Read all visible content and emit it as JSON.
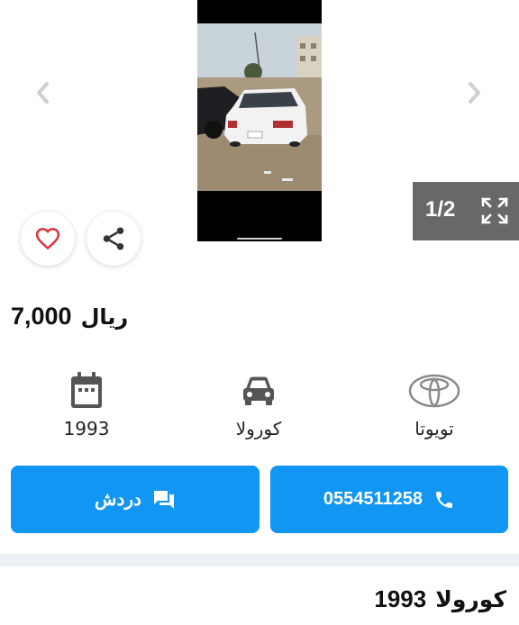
{
  "gallery": {
    "counter": "1/2",
    "icons": {
      "prev": "chevron-left-icon",
      "next": "chevron-right-icon",
      "expand": "fullscreen-icon"
    }
  },
  "actions": {
    "favorite_icon": "heart-outline-icon",
    "share_icon": "share-icon"
  },
  "listing": {
    "price": "7,000",
    "currency": "ريال",
    "year": "1993",
    "model": "كورولا",
    "make": "تويوتا",
    "title_model": "كورولا",
    "title_year": "1993"
  },
  "buttons": {
    "chat_label": "دردش",
    "phone": "0554511258"
  },
  "colors": {
    "primary": "#1196f3",
    "favorite": "#d9363e",
    "counter_bg": "#686868"
  }
}
